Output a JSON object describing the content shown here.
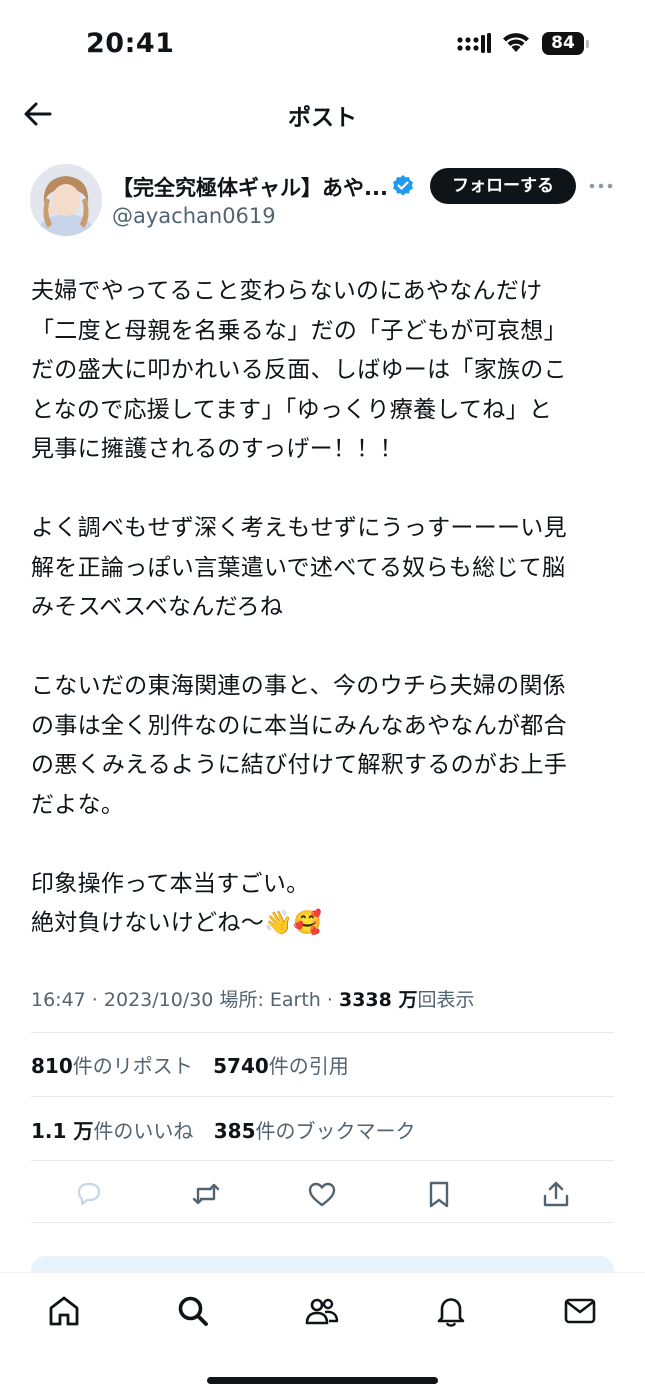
{
  "status_bar": {
    "time": "20:41",
    "battery": "84"
  },
  "header": {
    "title": "ポスト"
  },
  "author": {
    "display_name": "【完全究極体ギャル】あや...",
    "handle": "@ayachan0619",
    "follow_label": "フォローする"
  },
  "tweet": {
    "text": "夫婦でやってること変わらないのにあやなんだけ\n「二度と母親を名乗るな」だの「子どもが可哀想」\nだの盛大に叩かれいる反面、しばゆーは「家族のこ\nとなので応援してます」「ゆっくり療養してね」と\n見事に擁護されるのすっげー！！！\n\nよく調べもせず深く考えもせずにうっすーーーい見\n解を正論っぽい言葉遣いで述べてる奴らも総じて脳\nみそスベスベなんだろね\n\nこないだの東海関連の事と、今のウチら夫婦の関係\nの事は全く別件なのに本当にみんなあやなんが都合\nの悪くみえるように結び付けて解釈するのがお上手\nだよな。\n\n印象操作って本当すごい。\n絶対負けないけどね〜👋🥰"
  },
  "meta": {
    "time": "16:47",
    "date": "2023/10/30",
    "location": "場所: Earth",
    "views_count": "3338 万",
    "views_label": "回表示",
    "sep": " · "
  },
  "stats": {
    "reposts_count": "810",
    "reposts_label": "件のリポスト",
    "quotes_count": "5740",
    "quotes_label": "件の引用",
    "likes_count": "1.1 万",
    "likes_label": "件のいいね",
    "bookmarks_count": "385",
    "bookmarks_label": "件のブックマーク"
  },
  "icons": {
    "back": "arrow-left-icon",
    "verified": "verified-badge-icon",
    "more": "more-dots-icon",
    "reply": "reply-icon",
    "repost": "repost-icon",
    "like": "heart-icon",
    "bookmark": "bookmark-icon",
    "share": "share-icon",
    "nav": [
      "home-icon",
      "search-icon",
      "communities-icon",
      "notifications-icon",
      "messages-icon"
    ]
  },
  "colors": {
    "text": "#0f1419",
    "secondary": "#536471",
    "verified": "#1d9bf0",
    "reply_strip": "#e8f4fd"
  }
}
